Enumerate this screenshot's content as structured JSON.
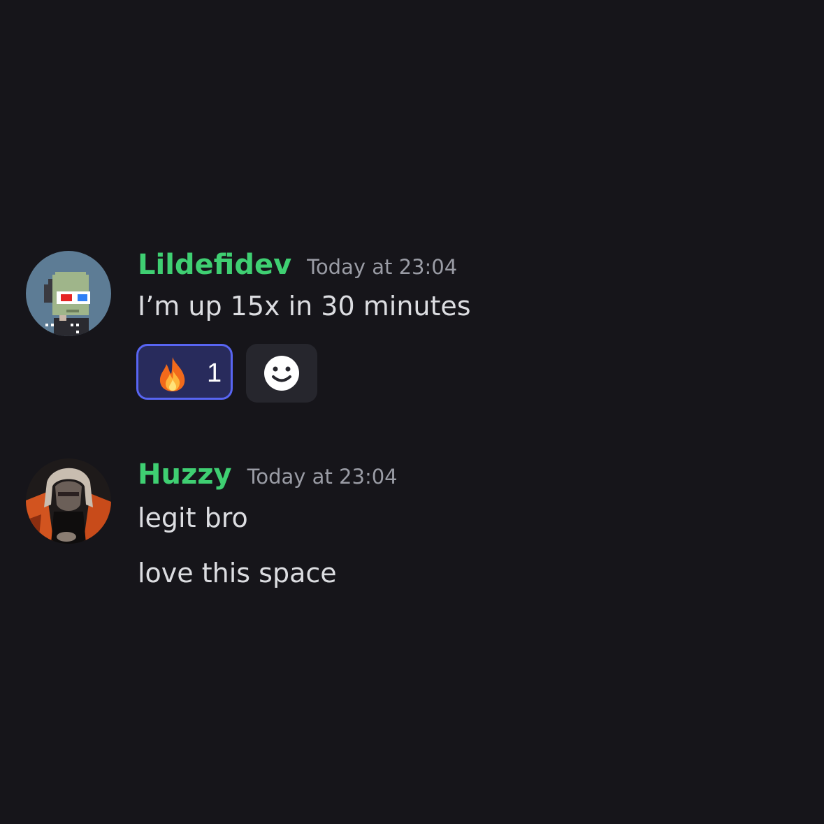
{
  "messages": [
    {
      "username": "Lildefidev",
      "timestamp": "Today at 23:04",
      "lines": [
        "I’m up 15x in 30 minutes"
      ],
      "reactions": [
        {
          "emoji": "fire-emoji",
          "count": "1",
          "selected": true
        }
      ]
    },
    {
      "username": "Huzzy",
      "timestamp": "Today at 23:04",
      "lines": [
        "legit bro",
        "love this space"
      ]
    }
  ],
  "colors": {
    "background": "#16151a",
    "username": "#3fcf72",
    "timestamp": "#9a9ca5",
    "text": "#dcdde1",
    "reaction_border": "#5865f2",
    "reaction_bg": "#282b5c",
    "add_reaction_bg": "#26262d"
  },
  "icons": {
    "add_reaction": "smiley-face-icon"
  }
}
